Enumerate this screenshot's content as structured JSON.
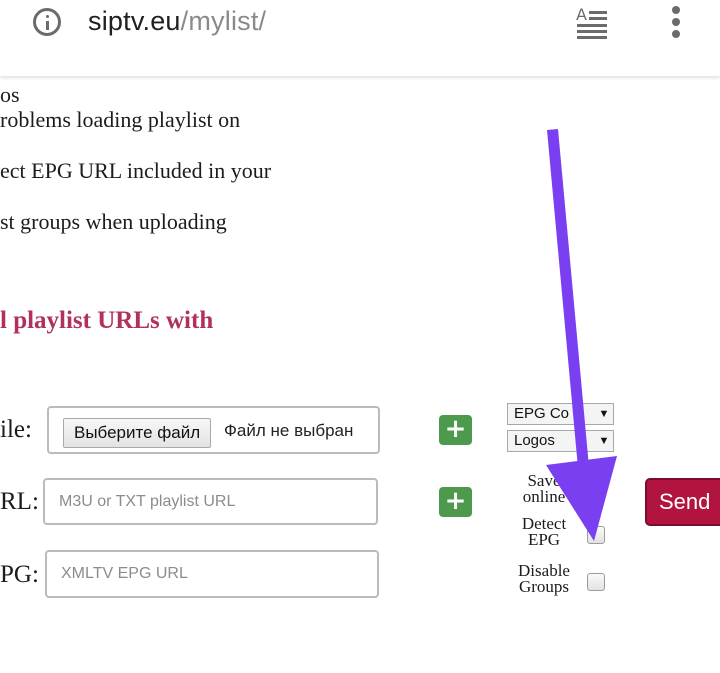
{
  "browser": {
    "url_domain": "siptv.eu",
    "url_path": "/mylist/",
    "icons": [
      "info-icon",
      "reader-mode-icon",
      "overflow-menu-icon"
    ]
  },
  "content": {
    "lines": [
      "os",
      "roblems loading playlist on",
      "ect EPG URL included in your",
      "st groups when uploading"
    ],
    "heading": "l playlist URLs with"
  },
  "form": {
    "file_label": "ile:",
    "url_label": "RL:",
    "epg_label": "PG:",
    "file_button": "Выберите файл",
    "file_status": "Файл не выбран",
    "url_placeholder": "M3U or TXT playlist URL",
    "epg_placeholder": "XMLTV EPG URL",
    "plus_symbol": "+",
    "epg_select": "EPG Co",
    "logos_select": "Logos",
    "select_arrow": "▼",
    "save_online_line1": "Save",
    "save_online_line2": "online",
    "detect_epg_line1": "Detect",
    "detect_epg_line2": "EPG",
    "disable_groups_line1": "Disable",
    "disable_groups_line2": "Groups",
    "send": "Send"
  },
  "colors": {
    "heading": "#b1305f",
    "plus_button": "#4d9a4d",
    "send_button": "#b0143f",
    "annotation_arrow": "#7b3ff2"
  }
}
